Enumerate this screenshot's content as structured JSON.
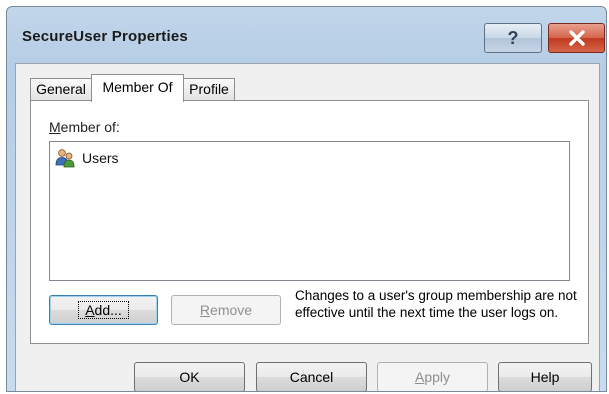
{
  "window": {
    "title": "SecureUser Properties",
    "help_button": "?",
    "close_icon": "close-icon"
  },
  "tabs": [
    {
      "label": "General",
      "active": false
    },
    {
      "label": "Member Of",
      "active": true
    },
    {
      "label": "Profile",
      "active": false
    }
  ],
  "member_of": {
    "label_mnemonic": "M",
    "label_rest": "ember of:",
    "items": [
      {
        "name": "Users",
        "icon": "user-group-icon"
      }
    ]
  },
  "buttons": {
    "add_mnemonic": "A",
    "add_rest": "dd...",
    "remove_mnemonic": "R",
    "remove_rest": "emove",
    "ok": "OK",
    "cancel": "Cancel",
    "apply_mnemonic": "A",
    "apply_rest": "pply",
    "help": "Help"
  },
  "note": "Changes to a user's group membership are not effective until the next time the user logs on.",
  "colors": {
    "titlebar": "#b5cde6",
    "close_button": "#c0391f",
    "default_button_border": "#3c7fb1"
  }
}
